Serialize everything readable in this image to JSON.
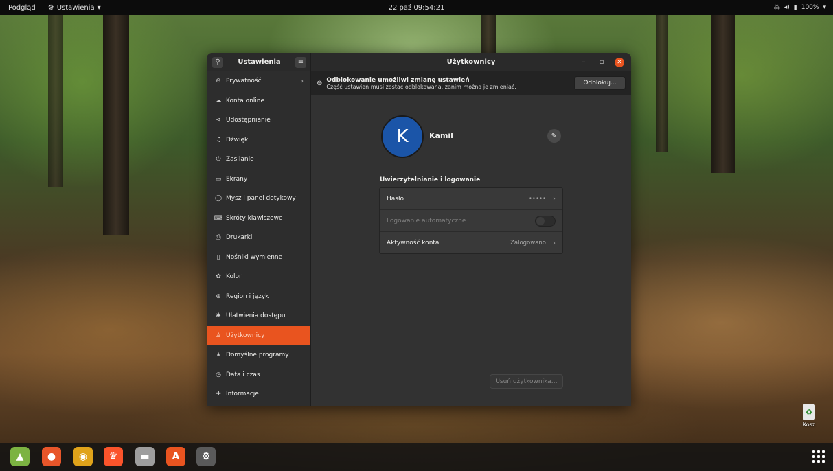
{
  "topbar": {
    "activities": "Podgląd",
    "app_menu": "Ustawienia",
    "app_menu_icon": "gear-icon",
    "clock": "22 paź  09:54:21",
    "battery": "100%"
  },
  "window": {
    "sidebar_title": "Ustawienia",
    "title": "Użytkownicy",
    "sidebar_items": [
      {
        "label": "Prywatność",
        "icon": "lock-icon",
        "glyph": "⊖",
        "chevron": true
      },
      {
        "label": "Konta online",
        "icon": "cloud-icon",
        "glyph": "☁"
      },
      {
        "label": "Udostępnianie",
        "icon": "share-icon",
        "glyph": "⋖"
      },
      {
        "label": "Dźwięk",
        "icon": "music-note-icon",
        "glyph": "♫"
      },
      {
        "label": "Zasilanie",
        "icon": "power-icon",
        "glyph": "⏻"
      },
      {
        "label": "Ekrany",
        "icon": "display-icon",
        "glyph": "▭"
      },
      {
        "label": "Mysz i panel dotykowy",
        "icon": "mouse-icon",
        "glyph": "◯"
      },
      {
        "label": "Skróty klawiszowe",
        "icon": "keyboard-icon",
        "glyph": "⌨"
      },
      {
        "label": "Drukarki",
        "icon": "printer-icon",
        "glyph": "⎙"
      },
      {
        "label": "Nośniki wymienne",
        "icon": "media-icon",
        "glyph": "▯"
      },
      {
        "label": "Kolor",
        "icon": "color-icon",
        "glyph": "✿"
      },
      {
        "label": "Region i język",
        "icon": "globe-icon",
        "glyph": "⊕"
      },
      {
        "label": "Ułatwienia dostępu",
        "icon": "accessibility-icon",
        "glyph": "✱"
      },
      {
        "label": "Użytkownicy",
        "icon": "users-icon",
        "glyph": "♙",
        "active": true
      },
      {
        "label": "Domyślne programy",
        "icon": "star-icon",
        "glyph": "★"
      },
      {
        "label": "Data i czas",
        "icon": "clock-icon",
        "glyph": "◷"
      },
      {
        "label": "Informacje",
        "icon": "info-icon",
        "glyph": "✚"
      }
    ]
  },
  "infobar": {
    "title": "Odblokowanie umożliwi zmianę ustawień",
    "subtitle": "Część ustawień musi zostać odblokowana, zanim można je zmieniać.",
    "unlock_button": "Odblokuj…"
  },
  "user": {
    "initial": "K",
    "name": "Kamil",
    "avatar_color": "#1b55a8"
  },
  "auth": {
    "section_title": "Uwierzytelnianie i logowanie",
    "password_label": "Hasło",
    "password_value": "•••••",
    "autologin_label": "Logowanie automatyczne",
    "autologin_on": false,
    "activity_label": "Aktywność konta",
    "activity_value": "Zalogowano"
  },
  "remove_user_button": "Usuń użytkownika…",
  "desktop": {
    "trash_label": "Kosz"
  },
  "dock": {
    "apps": [
      {
        "name": "android-studio",
        "color": "#7cb342",
        "glyph": "▲"
      },
      {
        "name": "firefox",
        "color": "#e8562a",
        "glyph": "●"
      },
      {
        "name": "chrome",
        "color": "#e0a31a",
        "glyph": "◉"
      },
      {
        "name": "brave",
        "color": "#fb542b",
        "glyph": "♛"
      },
      {
        "name": "files",
        "color": "#9e9e9e",
        "glyph": "▬"
      },
      {
        "name": "software",
        "color": "#e95420",
        "glyph": "A"
      },
      {
        "name": "settings",
        "color": "#5a5a5a",
        "glyph": "⚙"
      }
    ]
  },
  "colors": {
    "accent": "#e9541f",
    "window_bg": "#323232"
  }
}
